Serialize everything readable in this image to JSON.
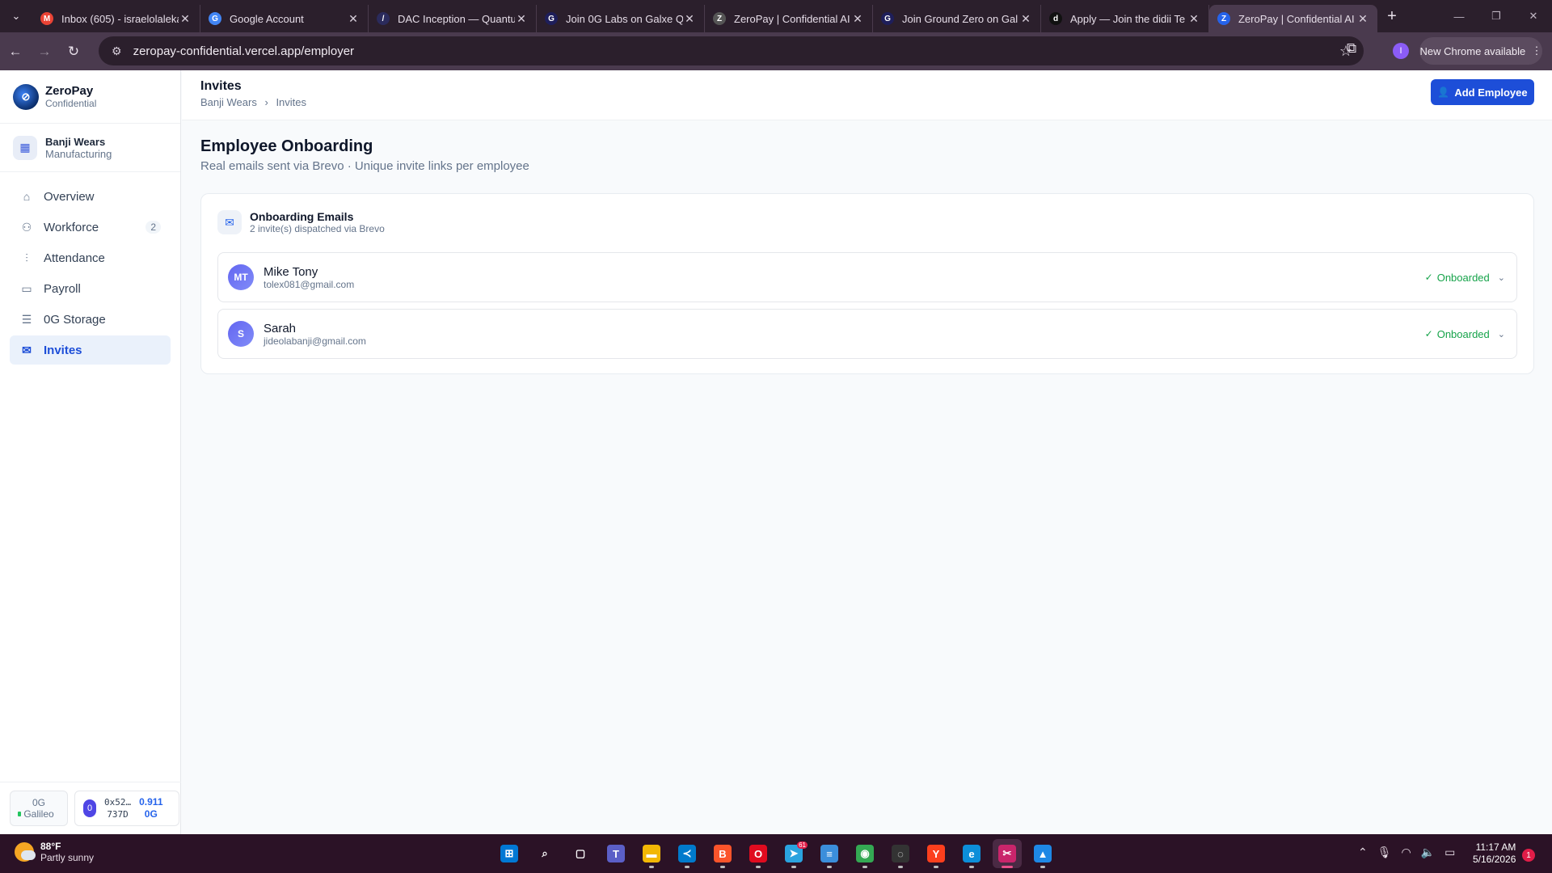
{
  "browser": {
    "tabs": [
      {
        "title": "Inbox (605) - israelolaleka",
        "favicon": "M",
        "color": "#ea4335"
      },
      {
        "title": "Google Account",
        "favicon": "G",
        "color": "#4285f4"
      },
      {
        "title": "DAC Inception — Quantu",
        "favicon": "/",
        "color": "#2b2b5c"
      },
      {
        "title": "Join 0G Labs on Galxe Qu",
        "favicon": "G",
        "color": "#1e1e5a"
      },
      {
        "title": "ZeroPay | Confidential AI",
        "favicon": "Z",
        "color": "#555"
      },
      {
        "title": "Join Ground Zero on Gal",
        "favicon": "G",
        "color": "#1e1e5a"
      },
      {
        "title": "Apply — Join the didii Te",
        "favicon": "d",
        "color": "#111"
      },
      {
        "title": "ZeroPay | Confidential AI",
        "favicon": "Z",
        "color": "#2563eb"
      }
    ],
    "active_tab": 7,
    "url": "zeropay-confidential.vercel.app/employer",
    "profile_initial": "I",
    "new_chrome_label": "New Chrome available"
  },
  "sidebar": {
    "brand_name": "ZeroPay",
    "brand_sub": "Confidential",
    "company_name": "Banji Wears",
    "company_type": "Manufacturing",
    "nav": [
      {
        "label": "Overview",
        "icon": "home-icon",
        "glyph": "⌂",
        "badge": "",
        "active": false
      },
      {
        "label": "Workforce",
        "icon": "users-icon",
        "glyph": "⚇",
        "badge": "2",
        "active": false
      },
      {
        "label": "Attendance",
        "icon": "bar-chart-icon",
        "glyph": "⫶",
        "badge": "",
        "active": false
      },
      {
        "label": "Payroll",
        "icon": "wallet-icon",
        "glyph": "▭",
        "badge": "",
        "active": false
      },
      {
        "label": "0G Storage",
        "icon": "database-icon",
        "glyph": "☰",
        "badge": "",
        "active": false
      },
      {
        "label": "Invites",
        "icon": "mail-icon",
        "glyph": "✉",
        "badge": "",
        "active": true
      }
    ],
    "network_line1": "0G",
    "network_line2": "Galileo",
    "wallet_addr1": "0x52…",
    "wallet_addr2": "737D",
    "wallet_bal1": "0.911",
    "wallet_bal2": "0G",
    "wallet_initial": "0"
  },
  "header": {
    "title": "Invites",
    "crumb_parent": "Banji Wears",
    "crumb_sep": "›",
    "crumb_current": "Invites",
    "add_button": "Add Employee"
  },
  "section": {
    "title": "Employee Onboarding",
    "subtitle": "Real emails sent via Brevo · Unique invite links per employee"
  },
  "card": {
    "title": "Onboarding Emails",
    "subtitle": "2 invite(s) dispatched via Brevo",
    "invites": [
      {
        "initials": "MT",
        "name": "Mike Tony",
        "email": "tolex081@gmail.com",
        "status": "Onboarded"
      },
      {
        "initials": "S",
        "name": "Sarah",
        "email": "jideolabanji@gmail.com",
        "status": "Onboarded"
      }
    ]
  },
  "taskbar": {
    "temp": "88°F",
    "weather": "Partly sunny",
    "time": "11:17 AM",
    "date": "5/16/2026",
    "notifications": "1",
    "telegram_badge": "61",
    "apps": [
      {
        "name": "windows-start-icon",
        "bg": "#0078d4",
        "glyph": "⊞"
      },
      {
        "name": "search-icon",
        "bg": "transparent",
        "glyph": "⌕"
      },
      {
        "name": "task-view-icon",
        "bg": "transparent",
        "glyph": "▢"
      },
      {
        "name": "teams-icon",
        "bg": "#5b5fc7",
        "glyph": "T"
      },
      {
        "name": "file-explorer-icon",
        "bg": "#f2b705",
        "glyph": "▬"
      },
      {
        "name": "vscode-icon",
        "bg": "#007acc",
        "glyph": "≺"
      },
      {
        "name": "brave-icon",
        "bg": "#fb542b",
        "glyph": "B"
      },
      {
        "name": "opera-icon",
        "bg": "#e00b1f",
        "glyph": "O"
      },
      {
        "name": "telegram-icon",
        "bg": "#2aa3df",
        "glyph": "➤"
      },
      {
        "name": "notepad-icon",
        "bg": "#3b8edb",
        "glyph": "≡"
      },
      {
        "name": "chrome-icon",
        "bg": "#34a853",
        "glyph": "◉"
      },
      {
        "name": "obs-icon",
        "bg": "#333",
        "glyph": "◌"
      },
      {
        "name": "yandex-icon",
        "bg": "#fc3f1d",
        "glyph": "Y"
      },
      {
        "name": "edge-icon",
        "bg": "#0c8ed9",
        "glyph": "e"
      },
      {
        "name": "snipping-tool-icon",
        "bg": "#c9256b",
        "glyph": "✂"
      },
      {
        "name": "photos-icon",
        "bg": "#1e88e5",
        "glyph": "▲"
      }
    ],
    "current_app": 14
  }
}
